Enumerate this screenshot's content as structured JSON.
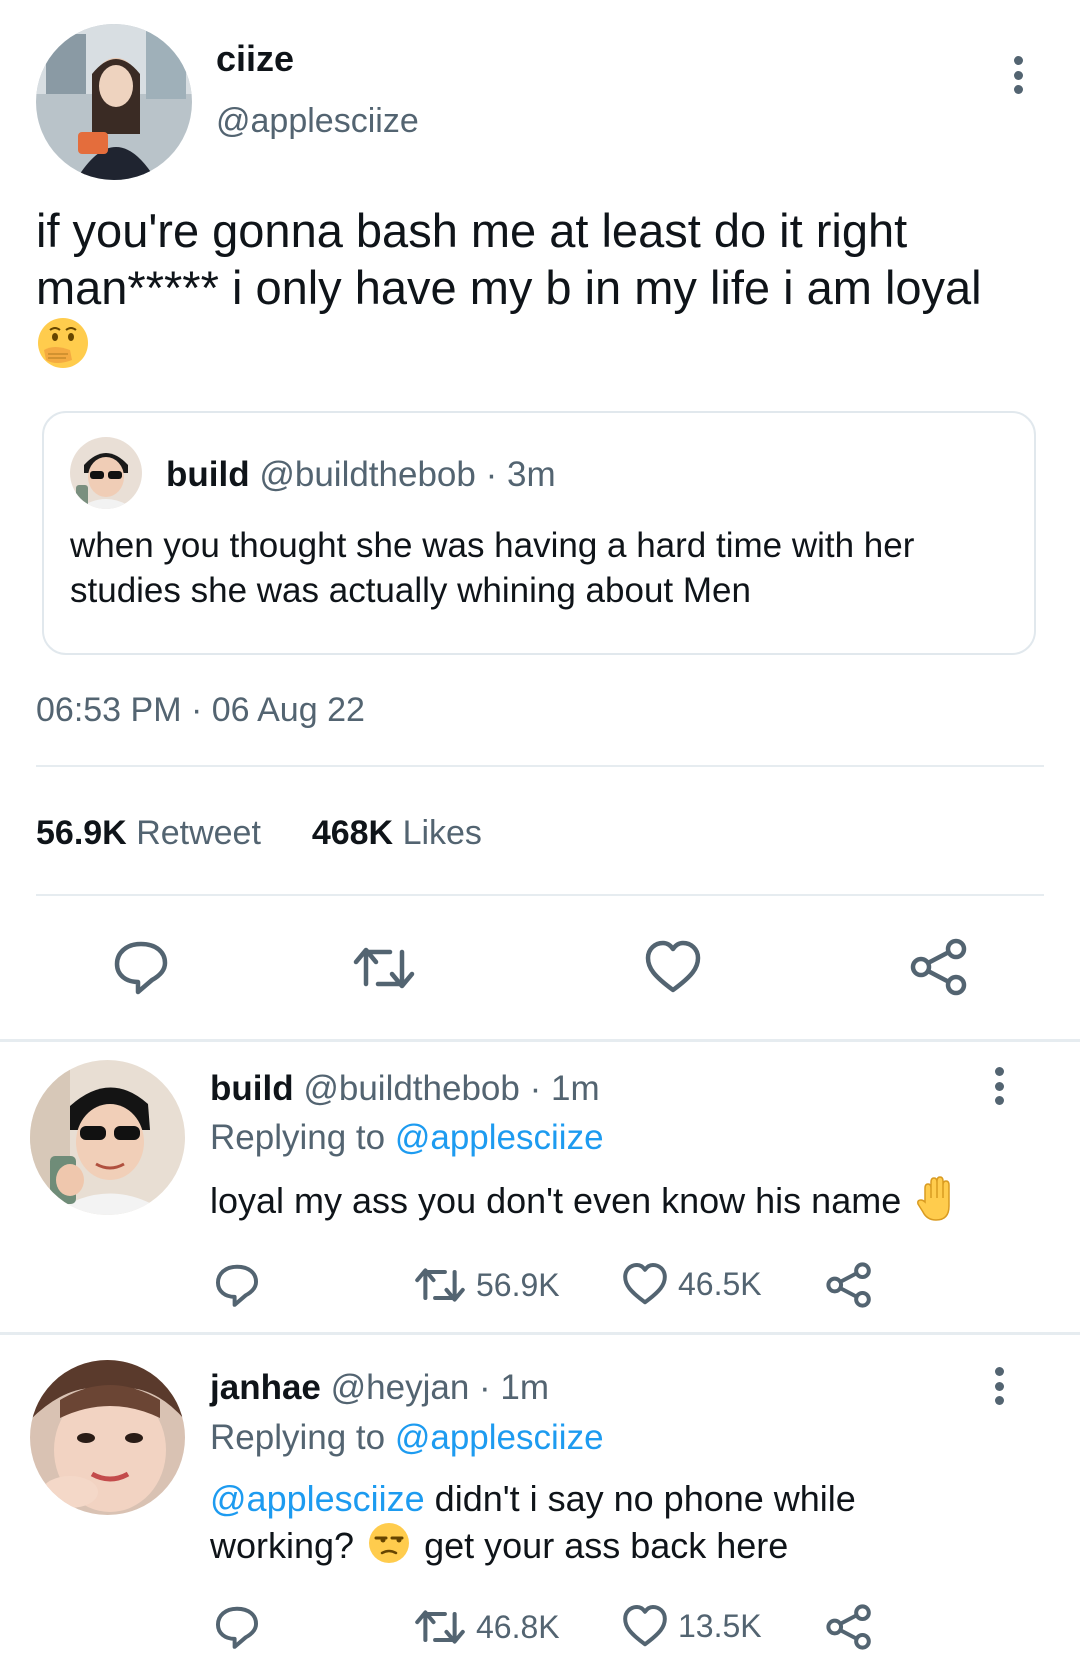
{
  "colors": {
    "accent": "#1d9bf0",
    "text": "#0f1419",
    "muted": "#536471",
    "divider": "#e6ecf0"
  },
  "main_tweet": {
    "display_name": "ciize",
    "handle": "@applesciize",
    "text_line1": "if you're gonna bash me at least do it right",
    "text_line2": "man***** i only have my b in my life i am loyal",
    "emoji": "face-with-hand-over-mouth-emoji",
    "quoted": {
      "name": "build",
      "handle": "@buildthebob",
      "time": "· 3m",
      "text_line1": "when you thought she was having a hard time with her",
      "text_line2": "studies she was actually whining about Men"
    },
    "timestamp": "06:53 PM · 06 Aug 22",
    "stats": {
      "retweets": "56.9K",
      "retweet_label": "Retweet",
      "likes": "468K",
      "likes_label": "Likes"
    },
    "actions": [
      "reply-icon",
      "retweet-icon",
      "like-icon",
      "share-icon"
    ]
  },
  "replies": [
    {
      "name": "build",
      "handle": "@buildthebob",
      "time": "· 1m",
      "replying_label": "Replying to",
      "replying_to": "@applesciize",
      "text": "loyal my ass you don't even know his name",
      "emoji": "raised-hand-emoji",
      "retweets": "56.9K",
      "likes": "46.5K"
    },
    {
      "name": "janhae",
      "handle": "@heyjan",
      "time": "· 1m",
      "replying_label": "Replying to",
      "replying_to": "@applesciize",
      "mention": "@applesciize",
      "text_line1": "didn't i say no phone while",
      "text_line2a": "working?",
      "text_line2b": "get your ass back here",
      "emoji": "unamused-face-emoji",
      "retweets": "46.8K",
      "likes": "13.5K"
    }
  ]
}
